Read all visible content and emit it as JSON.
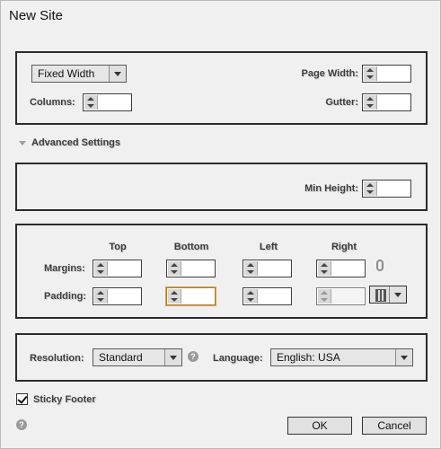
{
  "dialog": {
    "title": "New Site"
  },
  "layout": {
    "mode_select": "Fixed Width",
    "page_width_label": "Page Width:",
    "columns_label": "Columns:",
    "gutter_label": "Gutter:"
  },
  "advanced": {
    "label": "Advanced Settings",
    "min_height_label": "Min Height:"
  },
  "spacing": {
    "headers": [
      "Top",
      "Bottom",
      "Left",
      "Right"
    ],
    "margins_label": "Margins:",
    "padding_label": "Padding:"
  },
  "footer_settings": {
    "resolution_label": "Resolution:",
    "resolution_value": "Standard",
    "language_label": "Language:",
    "language_value": "English: USA",
    "help_icon": "?"
  },
  "sticky_footer": {
    "label": "Sticky Footer",
    "checked": true
  },
  "buttons": {
    "ok": "OK",
    "cancel": "Cancel"
  },
  "colors": {
    "accent_focus": "#e0a040",
    "border": "#2b2b2b"
  }
}
